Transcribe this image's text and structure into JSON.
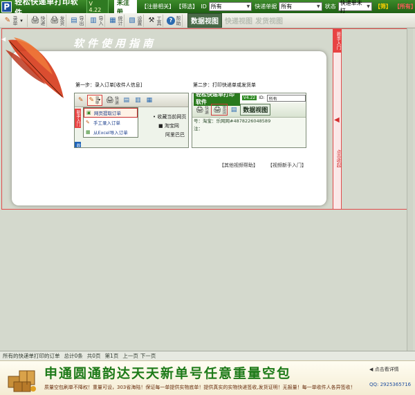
{
  "window": {
    "logo_letter": "P",
    "title": "轻松快递单打印软件",
    "version": "V 4.22",
    "unregistered": "未注册",
    "link_register": "【注册相关】",
    "link_filter": "【筛选】",
    "id_label": "ID",
    "id_value": "所有",
    "courier_label": "快递单据",
    "courier_value": "所有",
    "status_label": "状态",
    "status_value": "快递单未打",
    "btn_filter": "【筛】",
    "btn_all": "【所有】"
  },
  "toolbar": {
    "tools": [
      {
        "icon": "✎",
        "label": "录单"
      },
      {
        "icon": "▾",
        "label": ""
      },
      {
        "icon": "🖨",
        "label": "快递"
      },
      {
        "icon": "🖨",
        "label": "发货"
      },
      {
        "icon": "▤",
        "label": "导出"
      },
      {
        "icon": "▥",
        "label": "导入"
      },
      {
        "icon": "▦",
        "label": "统计"
      },
      {
        "icon": "▧",
        "label": "设置"
      },
      {
        "icon": "⚒",
        "label": "工具"
      },
      {
        "icon": "?",
        "label": "帮助"
      }
    ],
    "tab_active": "数据视图",
    "tab_courier": "快递视图",
    "tab_ship": "发货视图"
  },
  "guide": {
    "title": "软件使用指南",
    "step1_title": "第一步：录入订单[收件人信息]",
    "step2_title": "第二步：打印快递单或发货单",
    "step1_menu": [
      "网页提取订单",
      "手工录入订单",
      "从Excel导入订单"
    ],
    "step1_side_red": "新手入门",
    "step1_side_blue": "收件",
    "step1_bullets": [
      "• 收藏当前网页",
      "■ 淘宝网",
      "阿里巴巴"
    ],
    "step1_tool_labels": [
      "录单",
      "快递"
    ],
    "step2_app_title": "轻松快递单打印软件",
    "step2_version": "V4.22",
    "step2_id_label": "ID:",
    "step2_id_value": "所有",
    "step2_tab": "数据视图",
    "step2_tool_labels": [
      "快递",
      "发货"
    ],
    "step2_line1": "号：淘宝：乐网网#4878226048589",
    "step2_line2": "注：",
    "link_other_help": "【其他视频帮助】",
    "link_video_intro": "【视频新手入门】"
  },
  "rail": {
    "top_label": "新手入门",
    "collapse_text": "点击收起"
  },
  "status_bar": {
    "text": "所有的快递单打印的订单",
    "total": "总计0条",
    "pages": "共0页",
    "current": "第1页",
    "prev": "上一页",
    "next": "下一页"
  },
  "ad": {
    "headline": "申通圆通韵达天天新单号任意重量空包",
    "sub": "质量空包刷单不降权！重量可设，303省海陆！保证每一单提供实物底单！提供真实的实物快递签收,发货证明！无报量！每一单收件人各异签收！",
    "detail": "◀ 点击看详情",
    "qq": "QQ: 2925365716"
  }
}
